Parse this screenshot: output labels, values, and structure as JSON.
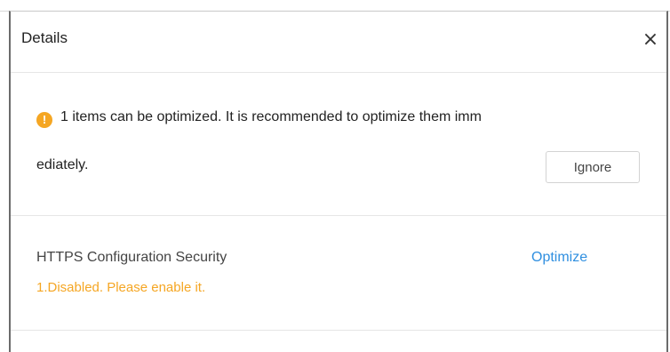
{
  "dialog": {
    "title": "Details",
    "close_symbol": "×"
  },
  "summary": {
    "warning_symbol": "!",
    "line1": "1 items can be optimized. It is recommended to optimize them imm",
    "line2": "ediately.",
    "ignore_label": "Ignore"
  },
  "items": [
    {
      "name": "HTTPS Configuration Security",
      "issue": "1.Disabled. Please enable it.",
      "action_label": "Optimize"
    }
  ],
  "colors": {
    "warning": "#f5a623",
    "link": "#2f8fe0"
  }
}
